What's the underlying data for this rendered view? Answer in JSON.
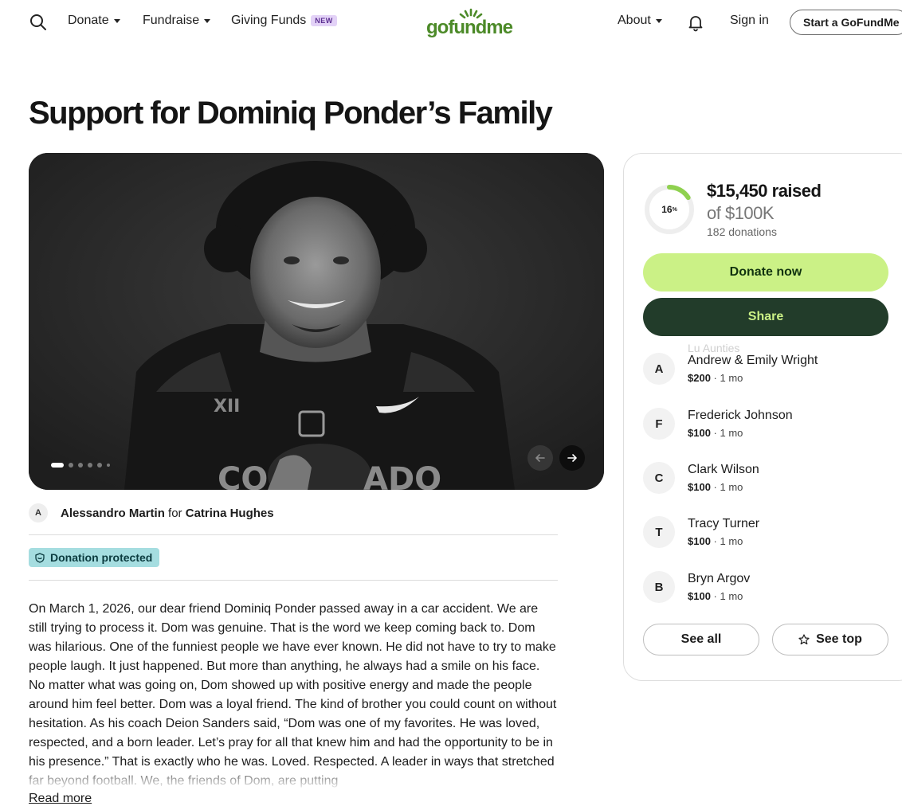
{
  "header": {
    "nav": [
      {
        "label": "Donate",
        "has_menu": true
      },
      {
        "label": "Fundraise",
        "has_menu": true
      },
      {
        "label": "Giving Funds",
        "badge": "NEW"
      }
    ],
    "logo_text": "gofundme",
    "about_label": "About",
    "signin_label": "Sign in",
    "start_label": "Start a GoFundMe"
  },
  "page_title": "Support for Dominiq Ponder’s Family",
  "hero": {
    "slide_count": 6,
    "active_slide": 1
  },
  "organizer": {
    "avatar_initial": "A",
    "name": "Alessandro Martin",
    "connector": "for",
    "beneficiary": "Catrina Hughes"
  },
  "protection": {
    "label": "Donation protected"
  },
  "story": {
    "text": "On March 1, 2026, our dear friend Dominiq Ponder passed away in a car accident. We are still trying to process it. Dom was genuine. That is the word we keep coming back to. Dom was hilarious. One of the funniest people we have ever known. He did not have to try to make people laugh. It just happened. But more than anything, he always had a smile on his face. No matter what was going on, Dom showed up with positive energy and made the people around him feel better. Dom was a loyal friend. The kind of brother you could count on without hesitation. As his coach Deion Sanders said, “Dom was one of my favorites. He was loved, respected, and a born leader. Let’s pray for all that knew him and had the opportunity to be in his presence.” That is exactly who he was. Loved. Respected. A leader in ways that stretched far beyond football. We, the friends of Dom, are putting",
    "read_more": "Read more"
  },
  "fundraiser": {
    "percent_label": "16",
    "percent_sign": "%",
    "progress_fraction": 0.16,
    "raised": "$15,450 raised",
    "goal": "of $100K",
    "donations": "182 donations",
    "donate_label": "Donate now",
    "share_label": "Share",
    "ghost_donor": "Lu Aunties",
    "donors": [
      {
        "initial": "A",
        "name": "Andrew & Emily Wright",
        "amount": "$200",
        "time": "1 mo"
      },
      {
        "initial": "F",
        "name": "Frederick Johnson",
        "amount": "$100",
        "time": "1 mo"
      },
      {
        "initial": "C",
        "name": "Clark Wilson",
        "amount": "$100",
        "time": "1 mo"
      },
      {
        "initial": "T",
        "name": "Tracy Turner",
        "amount": "$100",
        "time": "1 mo"
      },
      {
        "initial": "B",
        "name": "Bryn Argov",
        "amount": "$100",
        "time": "1 mo"
      }
    ],
    "see_all_label": "See all",
    "see_top_label": "See top"
  },
  "colors": {
    "brand_green": "#4c8a28",
    "donate_bg": "#cbf186",
    "share_bg": "#223c2a",
    "protected_bg": "#a5dde0",
    "new_badge_bg": "#e3d2f7"
  }
}
